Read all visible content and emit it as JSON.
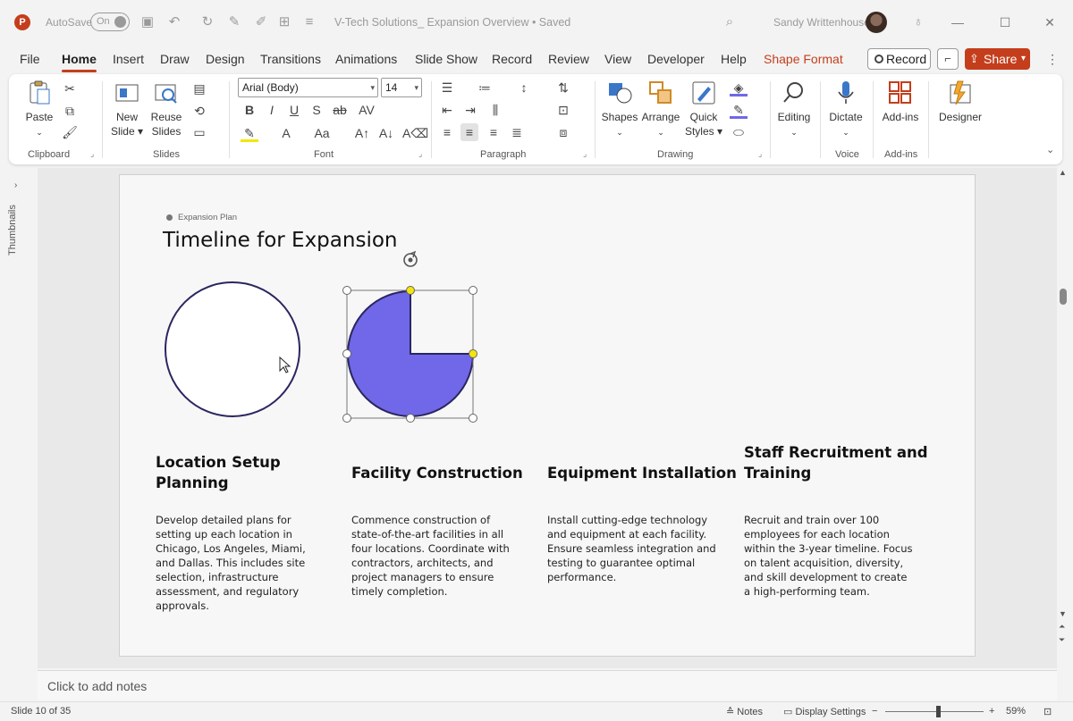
{
  "titlebar": {
    "app_icon": "P",
    "autosave_label": "AutoSave",
    "autosave_state": "On",
    "document_title": "V-Tech Solutions_ Expansion Overview • Saved",
    "user_name": "Sandy Writtenhouse",
    "icons": [
      "save-icon",
      "undo-icon",
      "redo-icon",
      "format-painter-icon",
      "customize-icon",
      "search-icon",
      "lightbulb-icon"
    ]
  },
  "tabs": {
    "items": [
      "File",
      "Home",
      "Insert",
      "Draw",
      "Design",
      "Transitions",
      "Animations",
      "Slide Show",
      "Record",
      "Review",
      "View",
      "Developer",
      "Help",
      "Shape Format"
    ],
    "active": "Home",
    "contextual": "Shape Format",
    "record_label": "Record",
    "share_label": "Share"
  },
  "ribbon": {
    "clipboard": {
      "paste": "Paste",
      "label": "Clipboard"
    },
    "slides": {
      "new_slide_1": "New",
      "new_slide_2": "Slide",
      "reuse_1": "Reuse",
      "reuse_2": "Slides",
      "label": "Slides"
    },
    "font": {
      "name": "Arial (Body)",
      "size": "14",
      "label": "Font"
    },
    "paragraph": {
      "label": "Paragraph"
    },
    "drawing": {
      "shapes": "Shapes",
      "arrange": "Arrange",
      "quick_1": "Quick",
      "quick_2": "Styles",
      "label": "Drawing"
    },
    "editing": {
      "label": "Editing"
    },
    "voice": {
      "dictate": "Dictate",
      "label": "Voice"
    },
    "addins": {
      "button": "Add-ins",
      "label": "Add-ins"
    },
    "designer": {
      "button": "Designer"
    }
  },
  "thumbnails": {
    "label": "Thumbnails"
  },
  "slide": {
    "eyebrow": "Expansion Plan",
    "title": "Timeline for Expansion",
    "colors": {
      "pie_fill": "#7068e8",
      "outline": "#2a2660",
      "handle_yellow": "#f5e50a"
    },
    "pie_fraction": 0.75,
    "columns": [
      {
        "title_1": "Location Setup",
        "title_2": "Planning",
        "lines": [
          "Develop detailed plans for",
          "setting up each location in",
          "Chicago, Los Angeles, Miami,",
          "and Dallas. This includes site",
          "selection, infrastructure",
          "assessment, and regulatory",
          "approvals."
        ]
      },
      {
        "title_1": "Facility Construction",
        "lines": [
          "Commence construction of",
          "state-of-the-art facilities in all",
          "four locations. Coordinate with",
          "contractors, architects, and",
          "project managers to ensure",
          "timely completion."
        ]
      },
      {
        "title_1": "Equipment Installation",
        "lines": [
          "Install cutting-edge technology",
          "and equipment at each facility.",
          "Ensure seamless integration and",
          "testing to guarantee optimal",
          "performance."
        ]
      },
      {
        "title_1": "Staff Recruitment and",
        "title_2": "Training",
        "lines": [
          "Recruit and train over 100",
          "employees for each location",
          "within the 3-year timeline. Focus",
          "on talent acquisition, diversity,",
          "and skill development to create",
          "a high-performing team."
        ]
      }
    ]
  },
  "notes": {
    "placeholder": "Click to add notes"
  },
  "status": {
    "slide_info": "Slide 10 of 35",
    "notes": "Notes",
    "display_settings": "Display Settings",
    "zoom": "59%"
  }
}
